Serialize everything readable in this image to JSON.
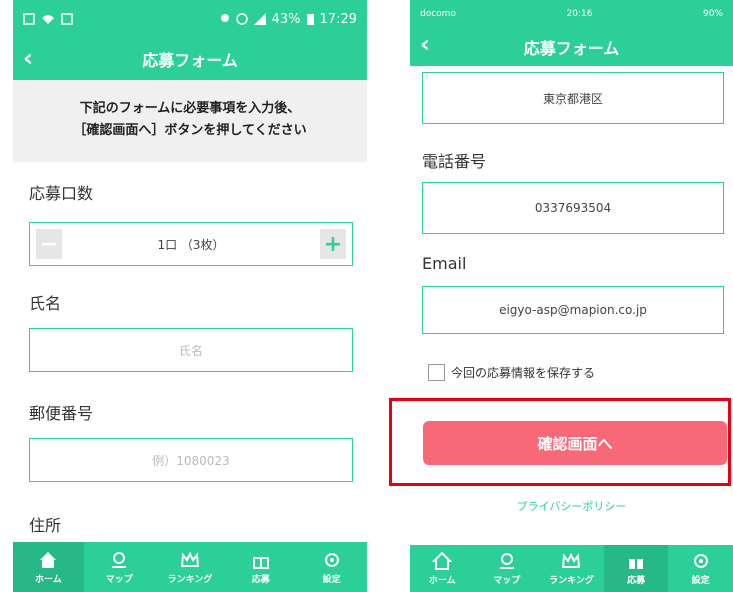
{
  "left": {
    "status": {
      "indicators": "43%",
      "time": "17:29"
    },
    "title": "応募フォーム",
    "notice": [
      "下記のフォームに必要事項を入力後、",
      "［確認画面へ］ボタンを押してください"
    ],
    "count": {
      "label": "応募口数",
      "value": "1口 （3枚）"
    },
    "name": {
      "label": "氏名",
      "placeholder": "氏名"
    },
    "postal": {
      "label": "郵便番号",
      "placeholder": "例）1080023"
    },
    "address": {
      "label": "住所"
    },
    "tabs": [
      "ホーム",
      "マップ",
      "ランキング",
      "応募",
      "設定"
    ],
    "active_tab": "ホーム"
  },
  "right": {
    "status": {
      "carrier": "docomo",
      "time": "20:16",
      "battery": "90%"
    },
    "title": "応募フォーム",
    "address_value": "東京都港区",
    "phone": {
      "label": "電話番号",
      "value": "0337693504"
    },
    "email": {
      "label": "Email",
      "value": "eigyo-asp@mapion.co.jp"
    },
    "save_label": "今回の応募情報を保存する",
    "confirm_button": "確認画面へ",
    "privacy_link": "プライバシーポリシー",
    "tabs": [
      "ホーム",
      "マップ",
      "ランキング",
      "応募",
      "設定"
    ],
    "active_tab": "応募"
  },
  "colors": {
    "brand": "#2ccf97",
    "confirm": "#f76878",
    "highlight": "#e60012"
  },
  "icons": [
    "home-icon",
    "map-pin-icon",
    "crown-icon",
    "gift-icon",
    "gear-icon"
  ]
}
